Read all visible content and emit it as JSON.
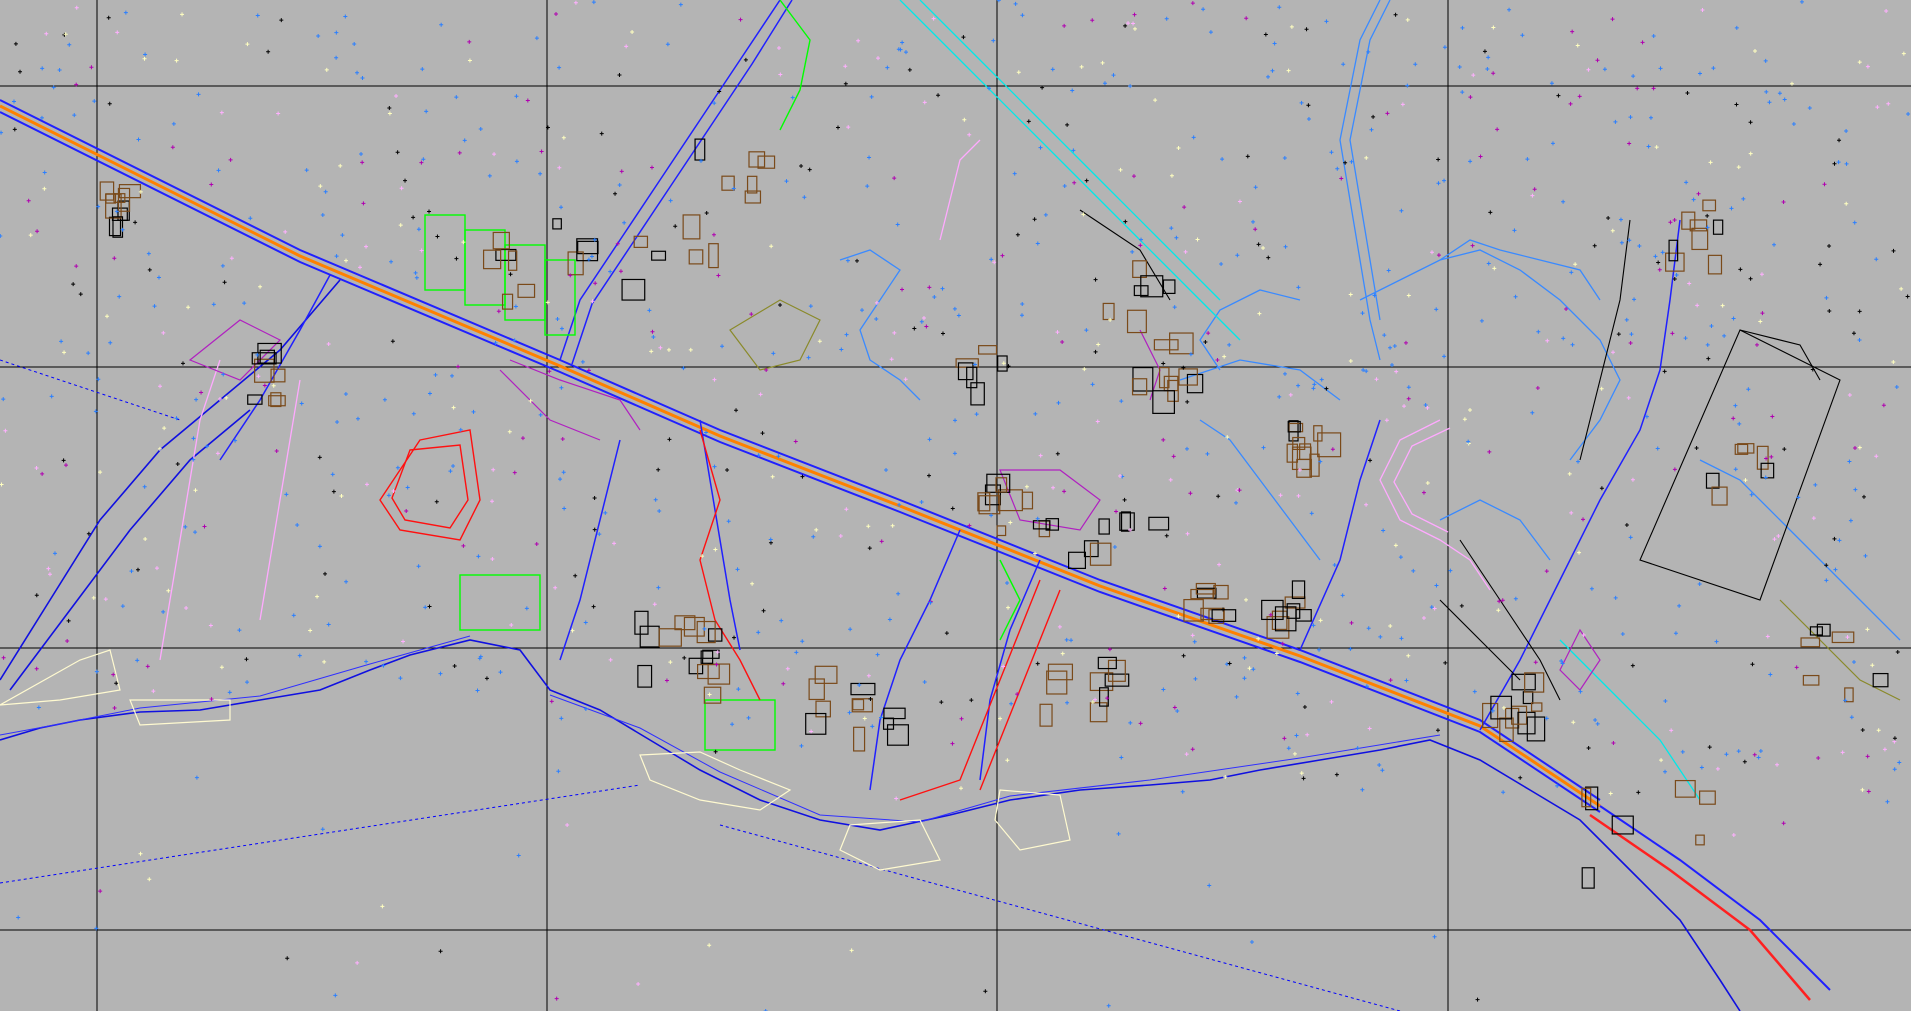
{
  "view": {
    "background": "#b4b4b4",
    "crosshair": "none"
  },
  "colors": {
    "grid": "#000000",
    "road_axis": "#ff8000",
    "roads": "#0000ff",
    "buildings": "#7a4a1a",
    "building_detail": "#000000",
    "green_plots": "#00ff00",
    "red_features": "#ff0000",
    "magenta_features": "#b000b0",
    "light_blue": "#2a7fff",
    "cyan": "#00e0e0",
    "pink": "#ffb0ff",
    "yellow_pale": "#ffffc0",
    "olive": "#8a8a2a",
    "shore": "#0000e0"
  },
  "layers": [
    {
      "name": "grid",
      "visible": true
    },
    {
      "name": "roads",
      "visible": true
    },
    {
      "name": "buildings",
      "visible": true
    },
    {
      "name": "survey-points",
      "visible": true
    },
    {
      "name": "shoreline",
      "visible": true
    }
  ]
}
